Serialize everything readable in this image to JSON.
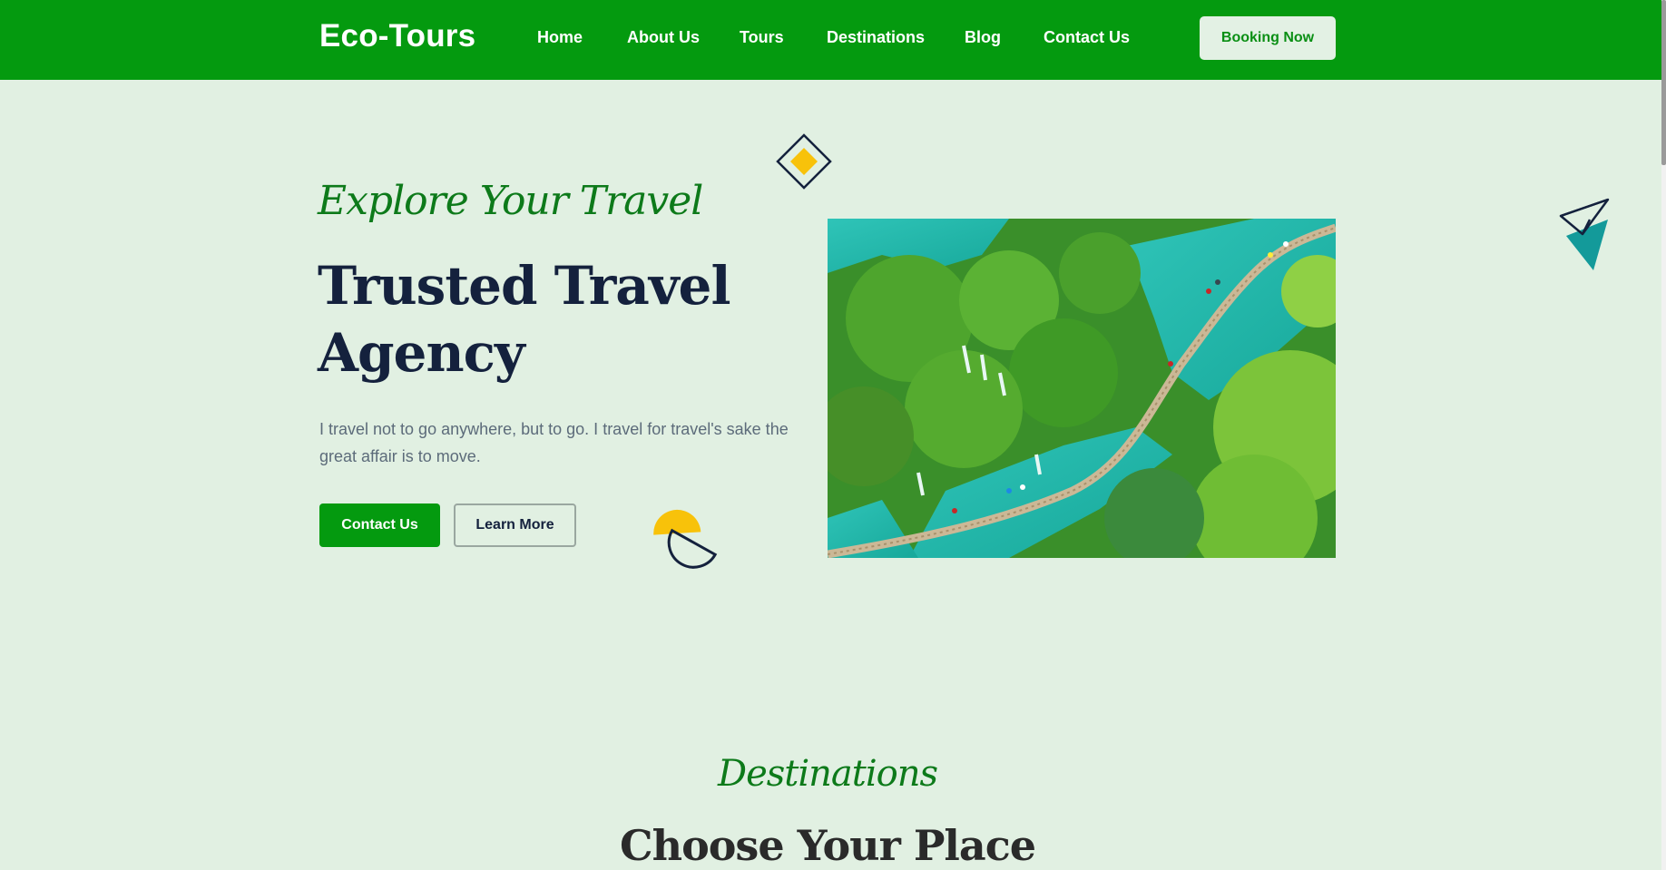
{
  "header": {
    "logo": "Eco-Tours",
    "nav": [
      {
        "label": "Home"
      },
      {
        "label": "About Us"
      },
      {
        "label": "Tours"
      },
      {
        "label": "Destinations"
      },
      {
        "label": "Blog"
      },
      {
        "label": "Contact Us"
      }
    ],
    "cta_label": "Booking Now"
  },
  "hero": {
    "eyebrow": "Explore Your Travel",
    "title": "Trusted Travel Agency",
    "text": "I travel not to go anywhere, but to go. I travel for travel's sake the great affair is to move.",
    "primary_button": "Contact Us",
    "secondary_button": "Learn More",
    "image_icon": "waterfall-boardwalk-photo"
  },
  "destinations": {
    "eyebrow": "Destinations",
    "title": "Choose Your Place"
  },
  "colors": {
    "brand_green": "#049a0f",
    "background": "#e1f0e2",
    "heading_navy": "#14213d",
    "accent_yellow": "#f8c20a",
    "accent_teal": "#139a9a"
  }
}
